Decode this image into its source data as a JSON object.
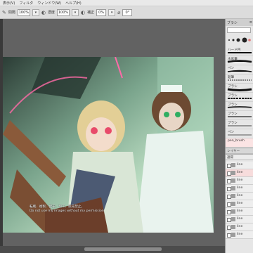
{
  "menubar": {
    "items": [
      "表示(V)",
      "フィルタ",
      "ウィンドウ(W)",
      "ヘルプ(H)"
    ]
  },
  "toolbar": {
    "size_label": "間隔",
    "size_value": "100%",
    "density_label": "濃度",
    "density_value": "100%",
    "corr_label": "補正",
    "corr_value": "0%",
    "angle_value": "0°"
  },
  "watermark": {
    "line1": "転載、複製、配布、加工、販売禁止。",
    "line2": "Do not use my images without my permission."
  },
  "panel": {
    "header_left": "ブラシ",
    "brushes": [
      {
        "label": "ハード円"
      },
      {
        "label": "水彩筆"
      },
      {
        "label": "ペン"
      },
      {
        "label": "鉛筆"
      },
      {
        "label": "ブラシ"
      },
      {
        "label": "ブラシ"
      },
      {
        "label": "ブラシ"
      },
      {
        "label": "ブラシ"
      },
      {
        "label": "ブラシ"
      },
      {
        "label": "ペン"
      }
    ],
    "brush_title": "pen_brush",
    "layers_header": "レイヤー",
    "blend_mode": "通常",
    "layers": [
      "line",
      "line",
      "line",
      "line",
      "line",
      "line",
      "line",
      "line",
      "line",
      "line"
    ]
  },
  "colors": {
    "accent": "#e27a7a",
    "canvas_bg": "#626262"
  }
}
